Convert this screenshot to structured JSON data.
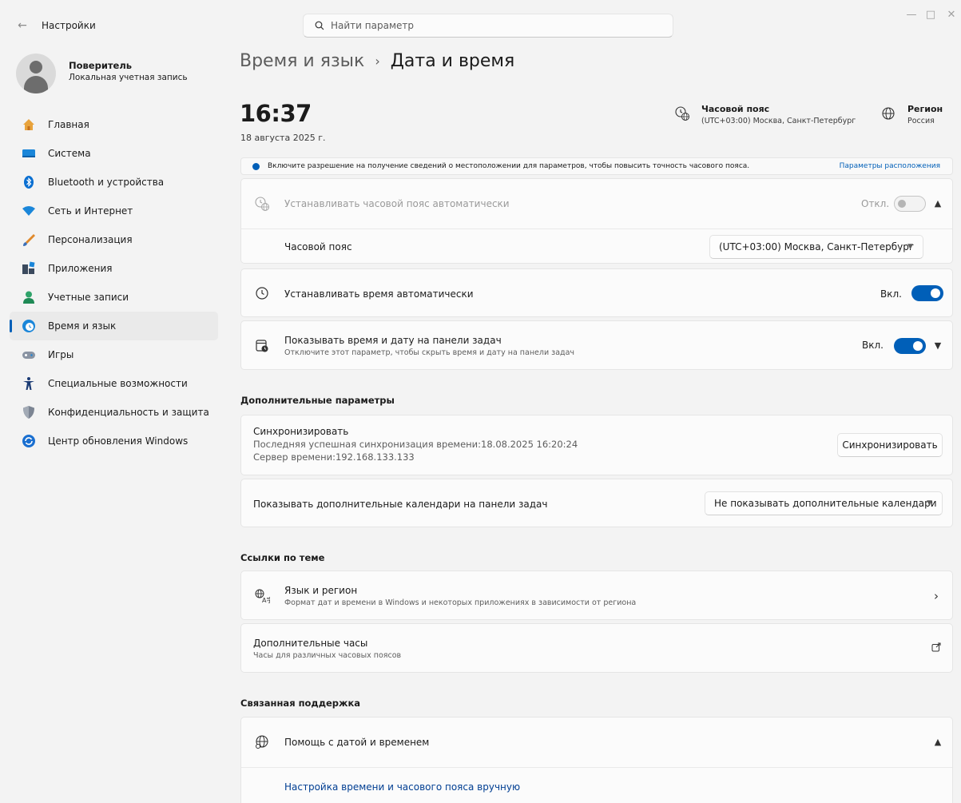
{
  "window": {
    "app_title": "Настройки",
    "back_icon": "←",
    "minimize_icon": "—",
    "maximize_icon": "□",
    "close_icon": "✕"
  },
  "search": {
    "placeholder": "Найти параметр",
    "icon": "⚲"
  },
  "profile": {
    "name": "Поверитель",
    "account_type": "Локальная учетная запись"
  },
  "sidebar": {
    "items": [
      {
        "label": "Главная",
        "icon": "home-icon"
      },
      {
        "label": "Система",
        "icon": "system-icon"
      },
      {
        "label": "Bluetooth и устройства",
        "icon": "bluetooth-icon"
      },
      {
        "label": "Сеть и Интернет",
        "icon": "wifi-icon"
      },
      {
        "label": "Персонализация",
        "icon": "brush-icon"
      },
      {
        "label": "Приложения",
        "icon": "apps-icon"
      },
      {
        "label": "Учетные записи",
        "icon": "accounts-icon"
      },
      {
        "label": "Время и язык",
        "icon": "time-language-icon",
        "active": true
      },
      {
        "label": "Игры",
        "icon": "gamepad-icon"
      },
      {
        "label": "Специальные возможности",
        "icon": "accessibility-icon"
      },
      {
        "label": "Конфиденциальность и защита",
        "icon": "shield-icon"
      },
      {
        "label": "Центр обновления Windows",
        "icon": "update-icon"
      }
    ]
  },
  "breadcrumb": {
    "parent": "Время и язык",
    "separator": "›",
    "current": "Дата и время"
  },
  "header": {
    "time": "16:37",
    "date": "18 августа 2025 г.",
    "timezone_title": "Часовой пояс",
    "timezone_value": "(UTC+03:00) Москва, Санкт-Петербург",
    "region_title": "Регион",
    "region_value": "Россия"
  },
  "infobar": {
    "message": "Включите разрешение на получение сведений о местоположении для параметров, чтобы повысить точность часового пояса.",
    "link": "Параметры расположения"
  },
  "auto_timezone": {
    "label": "Устанавливать часовой пояс автоматически",
    "state_label": "Откл.",
    "enabled": false
  },
  "timezone_row": {
    "label": "Часовой пояс",
    "value": "(UTC+03:00) Москва, Санкт-Петербург"
  },
  "auto_time": {
    "label": "Устанавливать время автоматически",
    "state_label": "Вкл.",
    "enabled": true
  },
  "taskbar_time": {
    "label": "Показывать время и дату на панели задач",
    "sub": "Отключите этот параметр, чтобы скрыть время и дату на панели задач",
    "state_label": "Вкл.",
    "enabled": true
  },
  "additional": {
    "title": "Дополнительные параметры",
    "sync_title": "Синхронизировать",
    "sync_last": "Последняя успешная синхронизация времени:18.08.2025 16:20:24",
    "sync_server": "Сервер времени:192.168.133.133",
    "sync_button": "Синхронизировать",
    "calendars_label": "Показывать дополнительные календари на панели задач",
    "calendars_value": "Не показывать дополнительные календари"
  },
  "related": {
    "title": "Ссылки по теме",
    "lang_title": "Язык и регион",
    "lang_sub": "Формат дат и времени в Windows и некоторых приложениях в зависимости от региона",
    "clocks_title": "Дополнительные часы",
    "clocks_sub": "Часы для различных часовых поясов"
  },
  "support": {
    "title": "Связанная поддержка",
    "help_title": "Помощь с датой и временем",
    "help_link": "Настройка времени и часового пояса вручную"
  },
  "colors": {
    "accent": "#005fb8",
    "background": "#f3f3f3",
    "card": "#fbfbfb"
  }
}
